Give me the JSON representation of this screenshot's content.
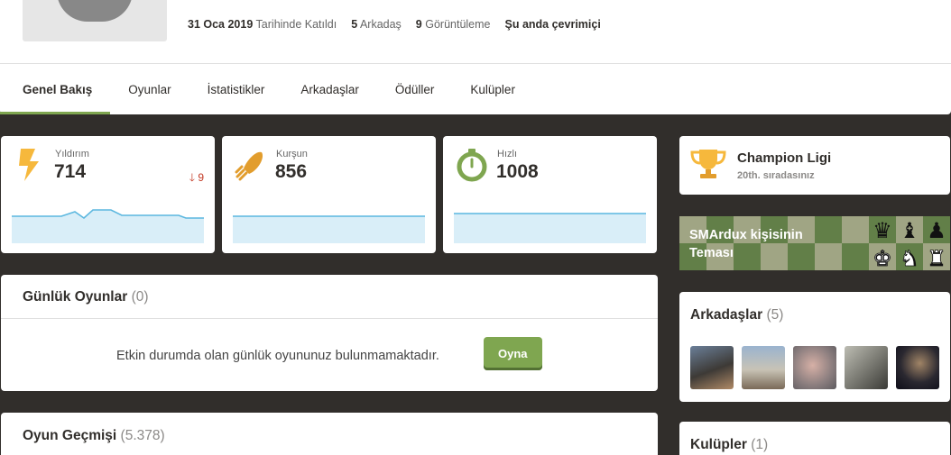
{
  "profile": {
    "joined_date": "31 Oca 2019",
    "joined_suffix": "Tarihinde Katıldı",
    "friends_count": "5",
    "friends_label": "Arkadaş",
    "views_count": "9",
    "views_label": "Görüntüleme",
    "status": "Şu anda çevrimiçi"
  },
  "tabs": [
    {
      "label": "Genel Bakış",
      "active": true
    },
    {
      "label": "Oyunlar"
    },
    {
      "label": "İstatistikler"
    },
    {
      "label": "Arkadaşlar"
    },
    {
      "label": "Ödüller"
    },
    {
      "label": "Kulüpler"
    }
  ],
  "ratings": [
    {
      "label": "Yıldırım",
      "value": "714",
      "delta": "9",
      "delta_direction": "down",
      "icon": "lightning-icon",
      "icon_color": "#f6b83c"
    },
    {
      "label": "Kurşun",
      "value": "856",
      "icon": "bullet-icon",
      "icon_color": "#e29d2d"
    },
    {
      "label": "Hızlı",
      "value": "1008",
      "icon": "stopwatch-icon",
      "icon_color": "#7fa650"
    }
  ],
  "daily": {
    "title": "Günlük Oyunlar",
    "count": "(0)",
    "empty_message": "Etkin durumda olan günlük oyununuz bulunmamaktadır.",
    "play_button": "Oyna"
  },
  "history": {
    "title": "Oyun Geçmişi",
    "count": "(5.378)"
  },
  "league": {
    "name": "Champion Ligi",
    "rank": "20th. sıradasınız",
    "icon": "trophy-icon"
  },
  "theme": {
    "title": "SMArdux kişisinin Teması"
  },
  "friends": {
    "title": "Arkadaşlar",
    "count": "(5)",
    "avatars": [
      "friend-1",
      "friend-2",
      "friend-3",
      "friend-4",
      "friend-5"
    ]
  },
  "clubs": {
    "title": "Kulüpler",
    "count": "(1)"
  },
  "colors": {
    "accent_green": "#7fa650",
    "background": "#312e2b",
    "down_red": "#c33a25",
    "spark_fill": "#d9eef8",
    "spark_line": "#5bb7df"
  }
}
